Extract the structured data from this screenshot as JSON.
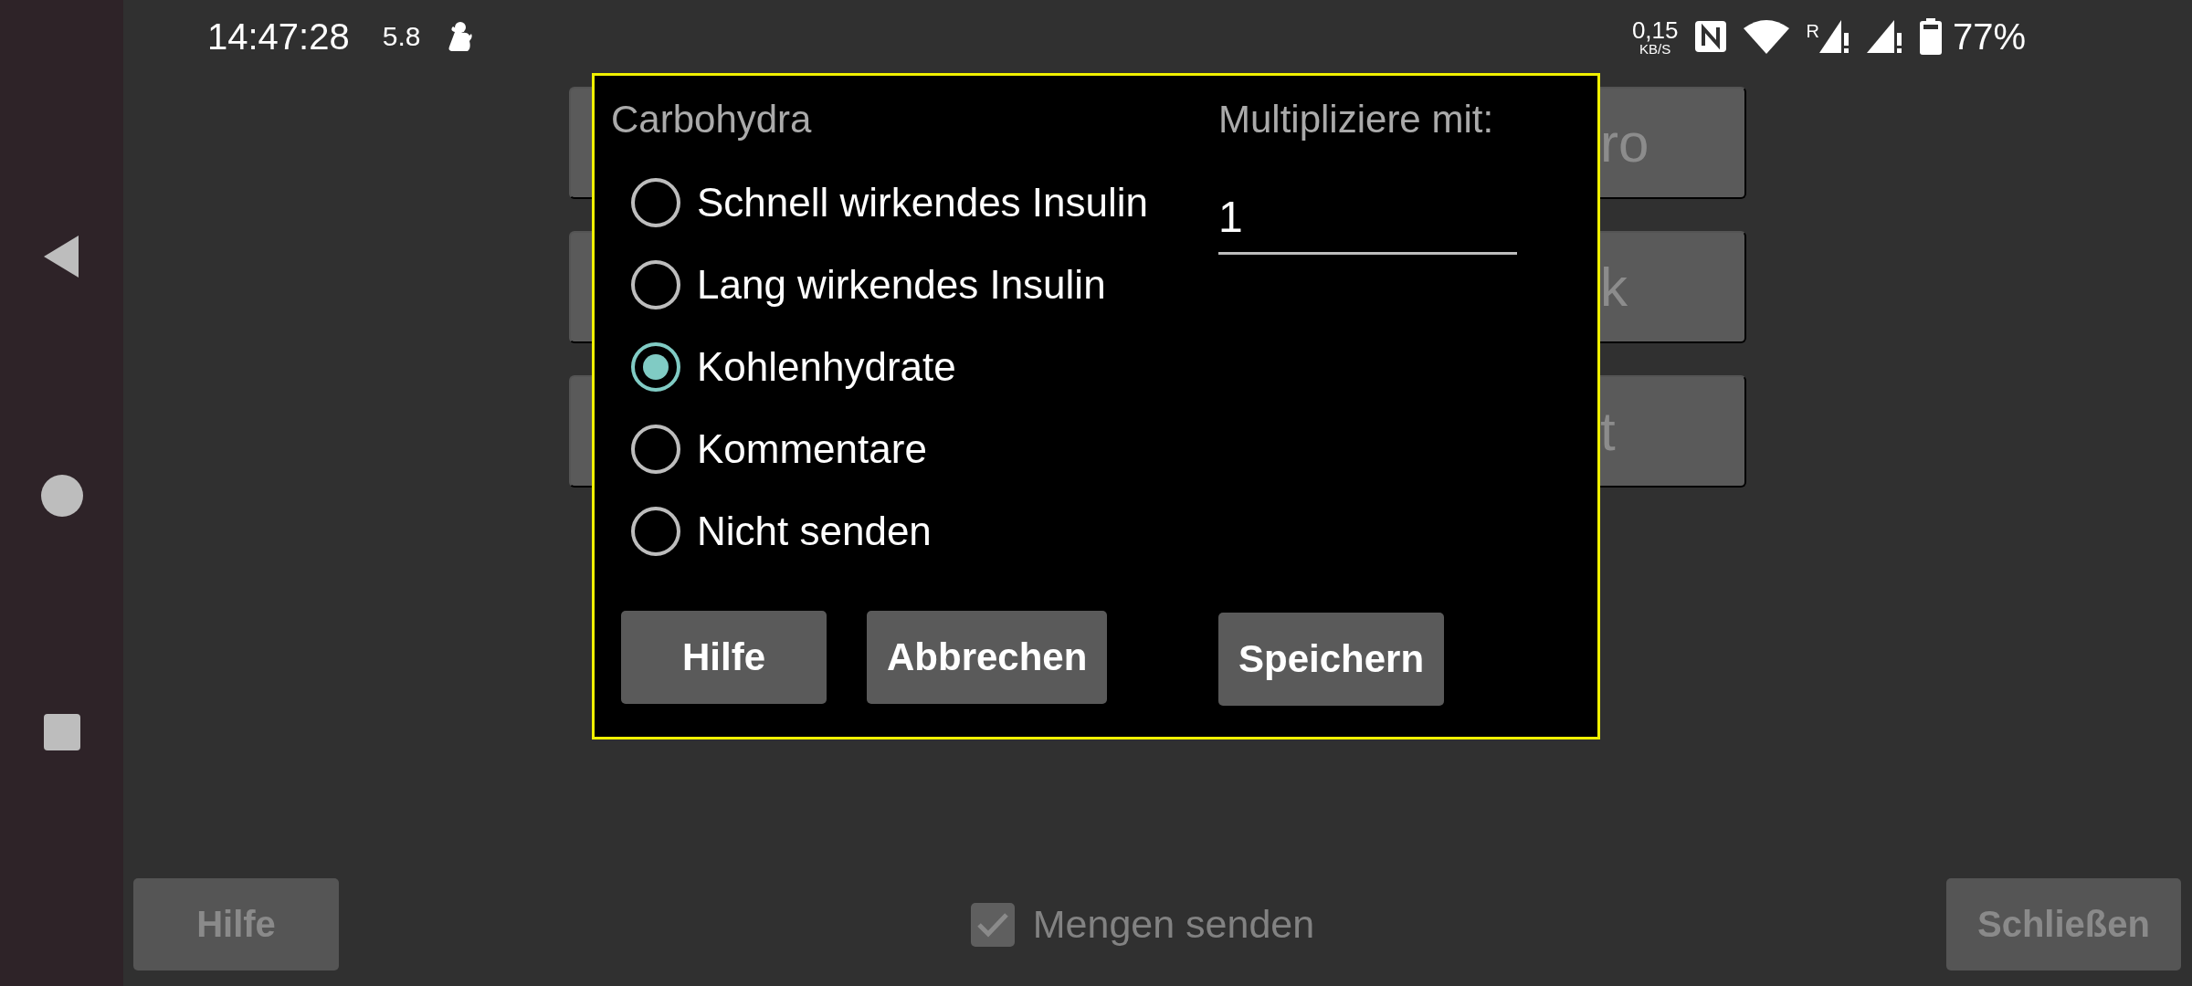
{
  "status_bar": {
    "time": "14:47:28",
    "indicator": "5.8",
    "net_speed": "0,15",
    "net_unit": "KB/S",
    "roaming": "R",
    "battery": "77%"
  },
  "background_buttons": [
    {
      "label": "ro"
    },
    {
      "label": "k"
    },
    {
      "label": "t"
    }
  ],
  "dialog": {
    "title": "Carbohydra",
    "options": [
      {
        "label": "Schnell wirkendes Insulin",
        "selected": false
      },
      {
        "label": "Lang wirkendes Insulin",
        "selected": false
      },
      {
        "label": "Kohlenhydrate",
        "selected": true
      },
      {
        "label": "Kommentare",
        "selected": false
      },
      {
        "label": "Nicht senden",
        "selected": false
      }
    ],
    "multiplier_label": "Multipliziere mit:",
    "multiplier": {
      "value": "1"
    },
    "buttons": [
      "Hilfe",
      "Abbrechen",
      "Speichern"
    ]
  },
  "footer": {
    "help_button": "Hilfe",
    "send_amounts": {
      "label": "Mengen senden",
      "checked": true
    },
    "close_button": "Schließen"
  }
}
